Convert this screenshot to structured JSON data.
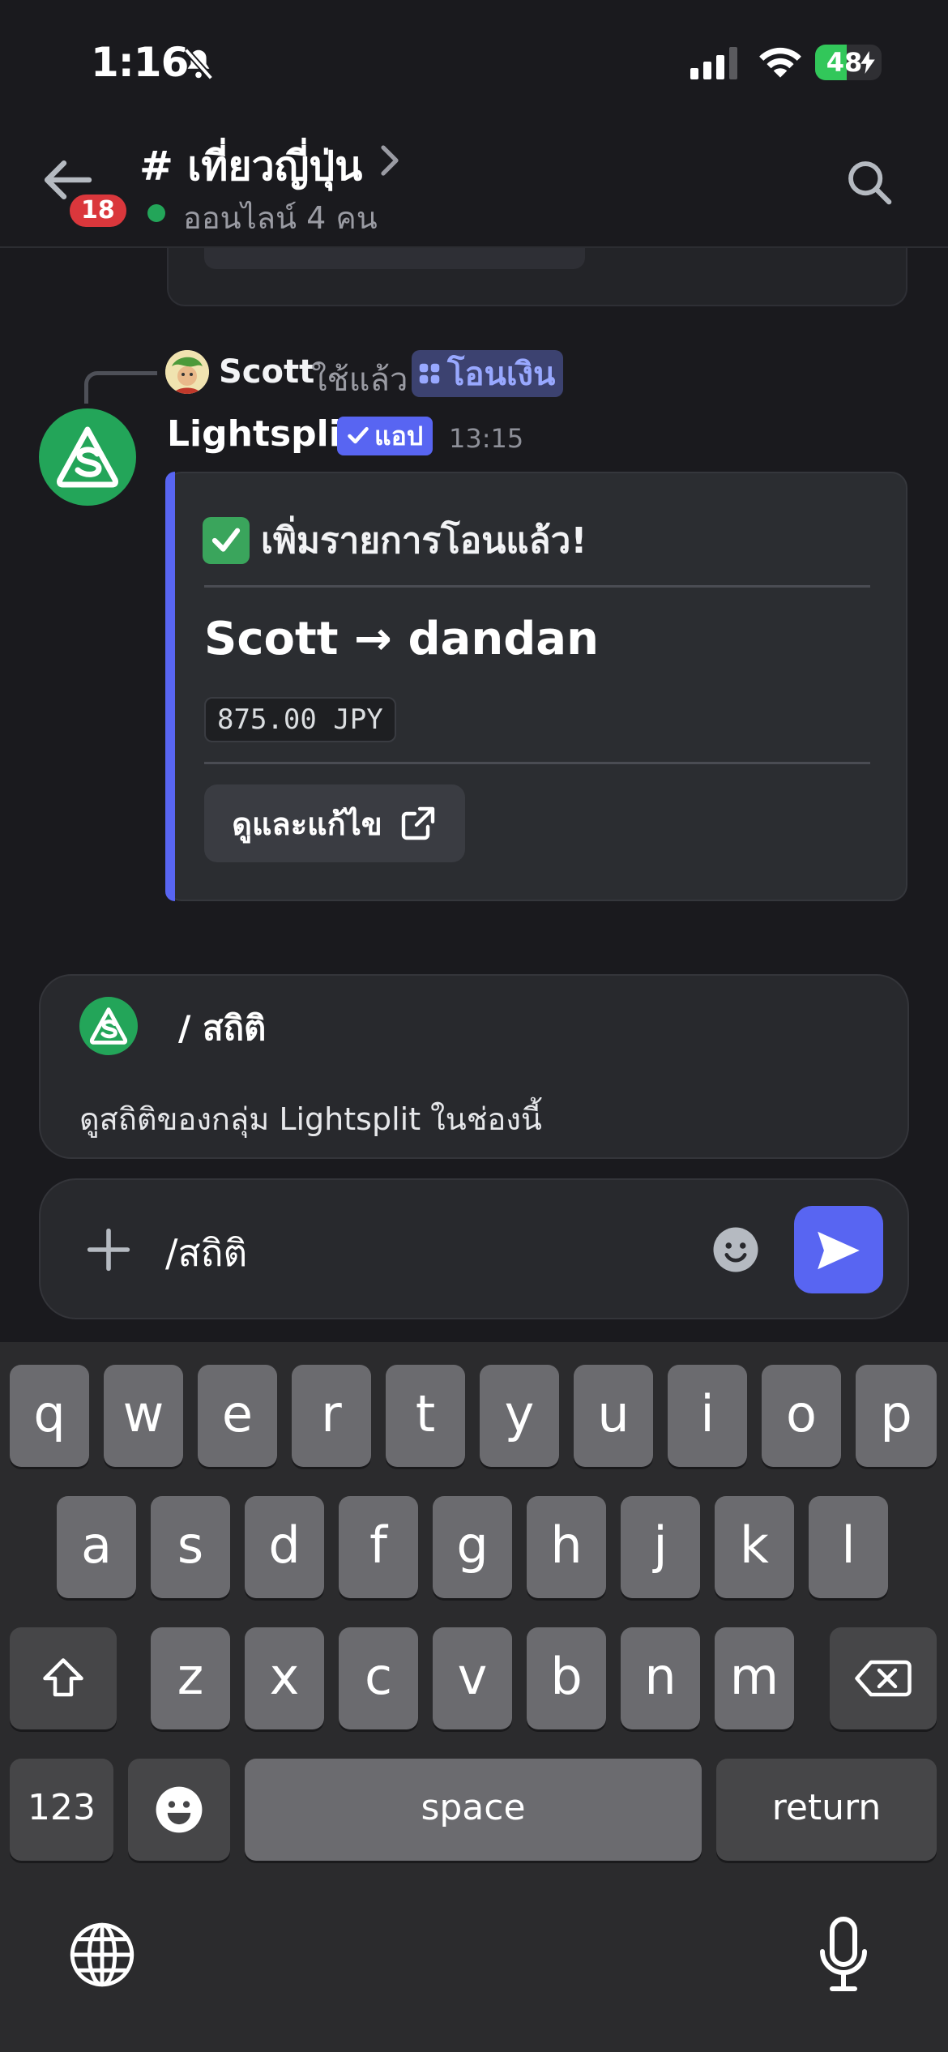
{
  "status_bar": {
    "time": "1:16",
    "battery": "48",
    "battery_level_percent": 48
  },
  "header": {
    "channel_name": "# เที่ยวญี่ปุ่น",
    "unread_count": "18",
    "online_text": "ออนไลน์ 4 คน"
  },
  "reply": {
    "user": "Scott",
    "used_text": "ใช้แล้ว",
    "command": "โอนเงิน"
  },
  "message": {
    "author": "Lightsplit",
    "badge": "แอป",
    "time": "13:15",
    "embed": {
      "title": "เพิ่มรายการโอนแล้ว!",
      "flow": "Scott → dandan",
      "amount": "875.00 JPY",
      "button_label": "ดูและแก้ไข"
    }
  },
  "suggestion": {
    "command": "/ สถิติ",
    "description": "ดูสถิติของกลุ่ม Lightsplit ในช่องนี้"
  },
  "composer": {
    "value": "/สถิติ"
  },
  "keyboard": {
    "row1": [
      "q",
      "w",
      "e",
      "r",
      "t",
      "y",
      "u",
      "i",
      "o",
      "p"
    ],
    "row2": [
      "a",
      "s",
      "d",
      "f",
      "g",
      "h",
      "j",
      "k",
      "l"
    ],
    "row3": [
      "z",
      "x",
      "c",
      "v",
      "b",
      "n",
      "m"
    ],
    "numbers": "123",
    "space": "space",
    "return": "return"
  },
  "colors": {
    "accent": "#5865f2",
    "online": "#23a559",
    "badge_red": "#da373c"
  }
}
